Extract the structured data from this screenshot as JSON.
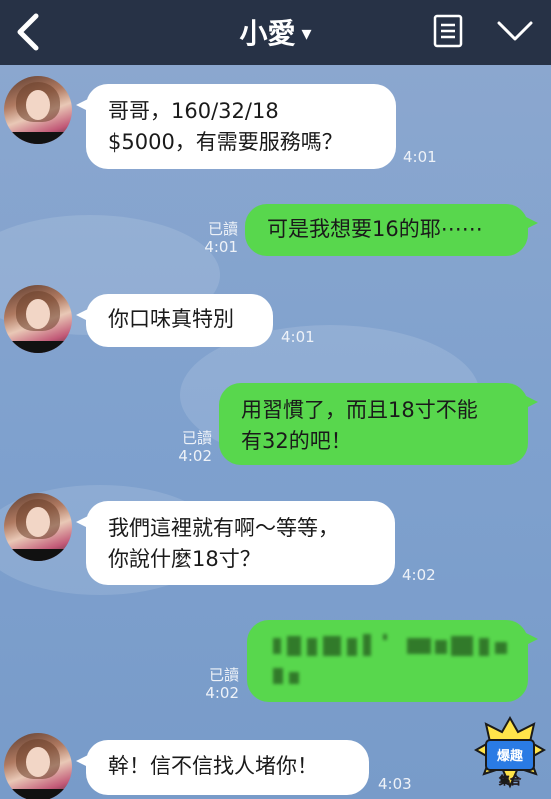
{
  "header": {
    "title": "小愛",
    "caret": "▾"
  },
  "messages": [
    {
      "dir": "in",
      "lines": [
        "哥哥，160/32/18",
        "$5000，有需要服務嗎？"
      ],
      "time": "4:01"
    },
    {
      "dir": "out",
      "lines": [
        "可是我想要16的耶⋯⋯"
      ],
      "read": "已讀",
      "time": "4:01"
    },
    {
      "dir": "in",
      "lines": [
        "你口味真特別"
      ],
      "time": "4:01"
    },
    {
      "dir": "out",
      "lines": [
        "用習慣了，而且18寸不能",
        "有32的吧！"
      ],
      "read": "已讀",
      "time": "4:02"
    },
    {
      "dir": "in",
      "lines": [
        "我們這裡就有啊～等等，",
        "你說什麼18寸？"
      ],
      "time": "4:02"
    },
    {
      "dir": "out",
      "lines": [],
      "read": "已讀",
      "time": "4:02"
    },
    {
      "dir": "in",
      "lines": [
        "幹！信不信找人堵你！"
      ],
      "time": "4:03"
    }
  ],
  "colors": {
    "header": "#273246",
    "chat_bg": "#7fa1ce",
    "outgoing": "#58d74d",
    "incoming": "#ffffff"
  },
  "icons": {
    "back": "chevron-left-icon",
    "note": "note-icon",
    "menu": "chevron-down-icon"
  },
  "logo": {
    "text": "爆趣集合"
  }
}
